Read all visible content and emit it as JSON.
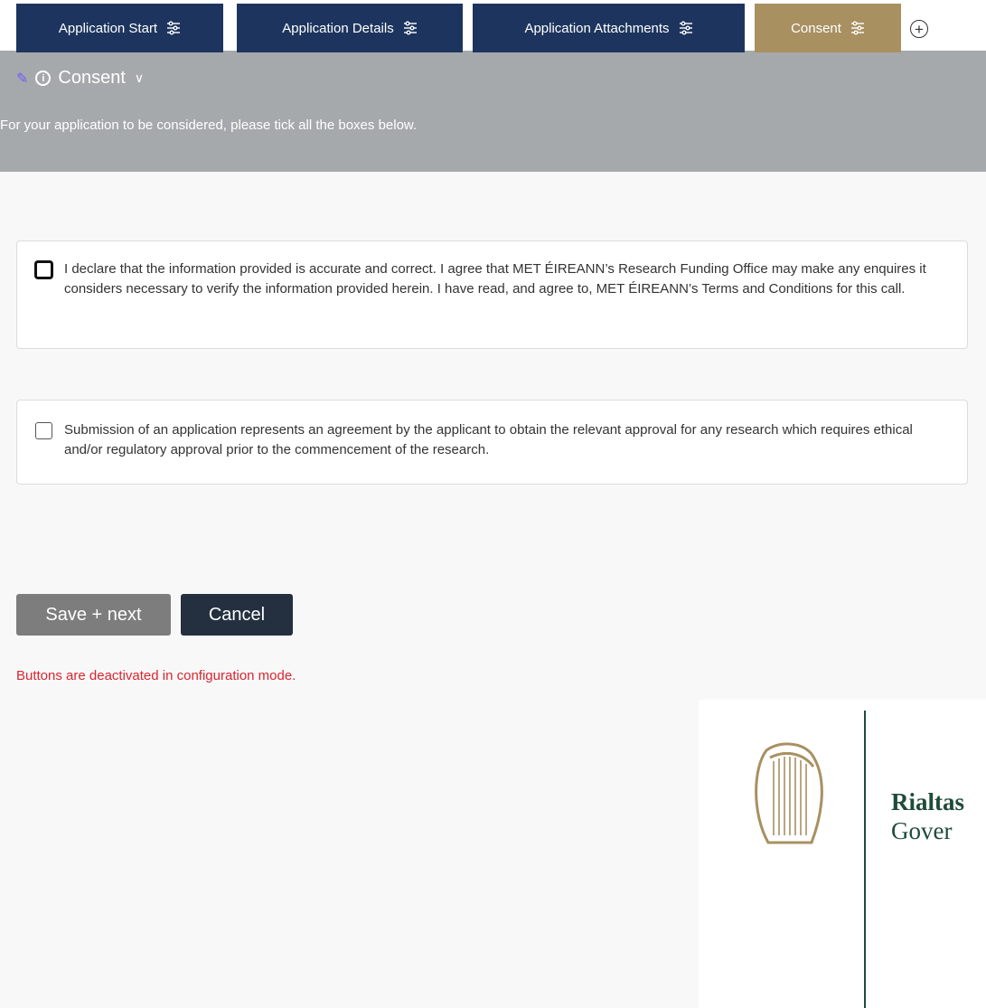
{
  "tabs": [
    {
      "label": "Application Start"
    },
    {
      "label": "Application Details"
    },
    {
      "label": "Application Attachments"
    },
    {
      "label": "Consent",
      "active": true
    }
  ],
  "section": {
    "title": "Consent",
    "instructions": "For your application to be considered, please tick all the boxes below."
  },
  "consents": [
    {
      "text": "I declare that the information provided is accurate and correct. I agree that MET ÉIREANN’s Research Funding Office may make any enquires it considers necessary to verify the information provided herein. I have read, and agree to, MET ÉIREANN’s Terms and Conditions for this call.",
      "checked": false
    },
    {
      "text": "Submission of an application represents an agreement by the applicant to obtain the relevant approval for any research which requires ethical and/or regulatory approval prior to the commencement of the research.",
      "checked": false
    }
  ],
  "actions": {
    "save_label": "Save + next",
    "cancel_label": "Cancel",
    "warning": "Buttons are deactivated in configuration mode."
  },
  "footer_logo": {
    "line1": "Rialtas",
    "line2": "Gover"
  },
  "colors": {
    "tab_bg": "#1d355e",
    "tab_active_bg": "#a89061",
    "band_bg": "#a6a9ab",
    "warning": "#d9262f",
    "logo_green": "#1f4b3a"
  }
}
